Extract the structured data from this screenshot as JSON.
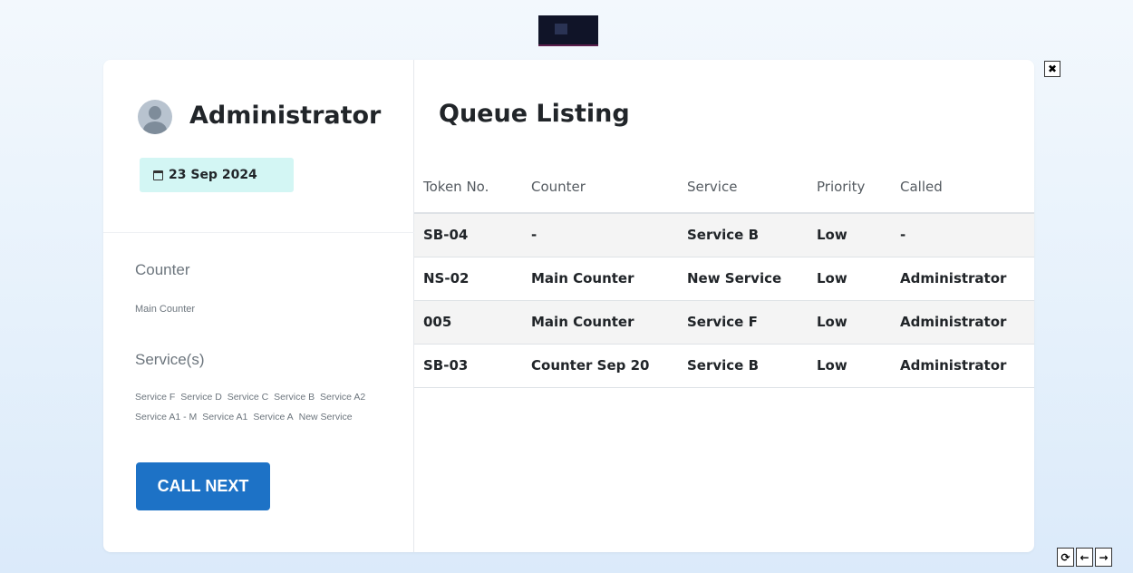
{
  "profile": {
    "name": "Administrator",
    "date": "23 Sep 2024"
  },
  "counter": {
    "label": "Counter",
    "value": "Main Counter"
  },
  "services": {
    "label": "Service(s)",
    "items": [
      "Service F",
      "Service D",
      "Service C",
      "Service B",
      "Service A2",
      "Service A1 - M",
      "Service A1",
      "Service A",
      "New Service"
    ]
  },
  "call_next_label": "CALL NEXT",
  "queue": {
    "title": "Queue Listing",
    "columns": [
      "Token No.",
      "Counter",
      "Service",
      "Priority",
      "Called"
    ],
    "rows": [
      [
        "SB-04",
        "-",
        "Service B",
        "Low",
        "-"
      ],
      [
        "NS-02",
        "Main Counter",
        "New Service",
        "Low",
        "Administrator"
      ],
      [
        "005",
        "Main Counter",
        "Service F",
        "Low",
        "Administrator"
      ],
      [
        "SB-03",
        "Counter Sep 20",
        "Service B",
        "Low",
        "Administrator"
      ]
    ]
  },
  "controls": {
    "close": "✖",
    "refresh": "⟳",
    "back": "←",
    "forward": "→"
  },
  "colors": {
    "accent": "#1d72c6",
    "date_badge_bg": "#d3f6f4"
  }
}
